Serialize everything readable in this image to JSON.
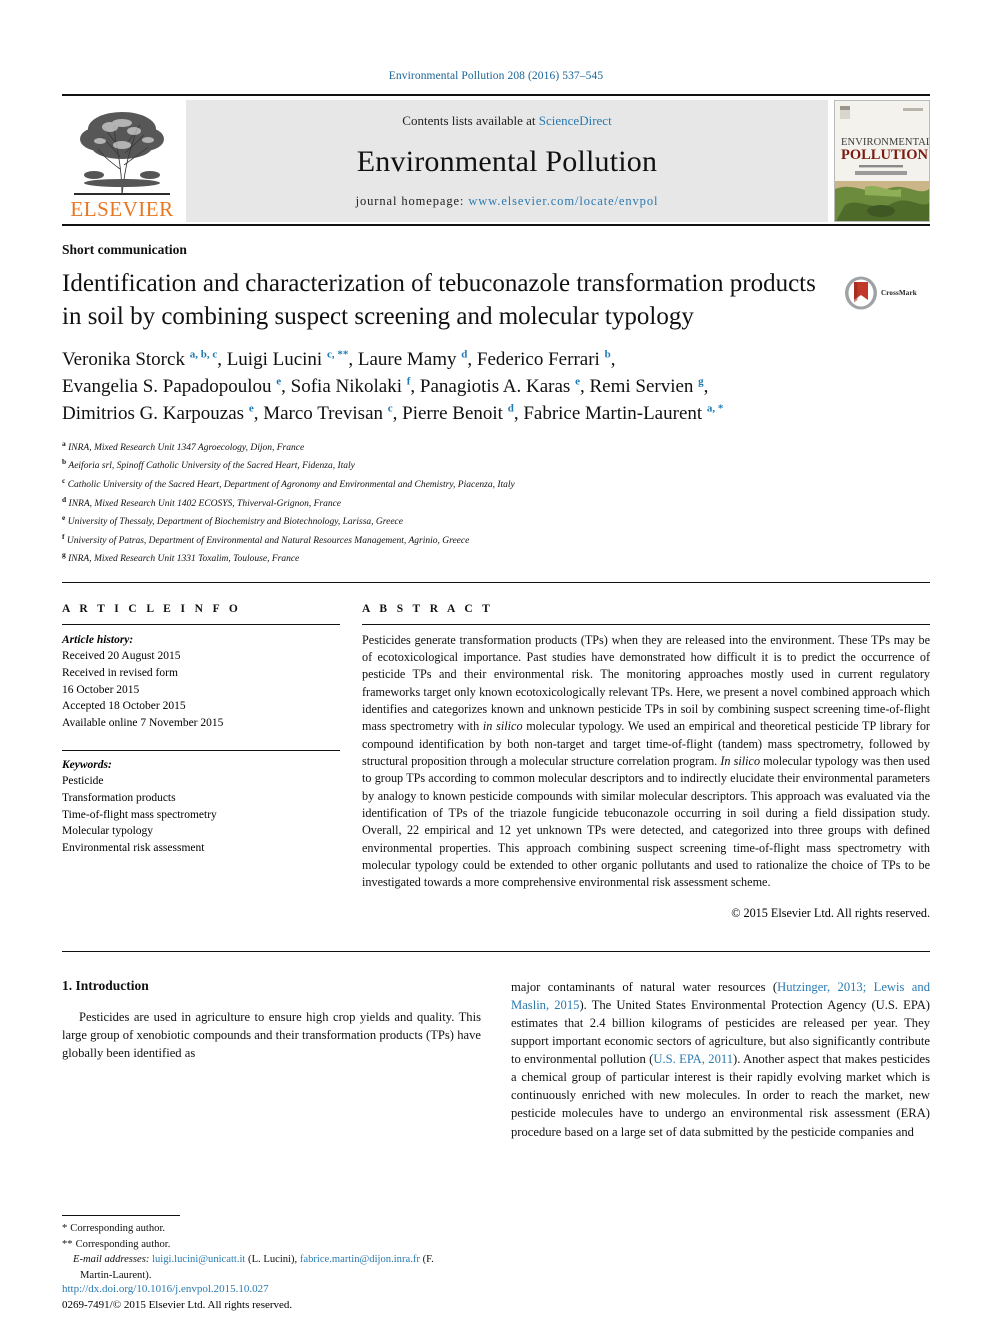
{
  "running_head": "Environmental Pollution 208 (2016) 537–545",
  "masthead": {
    "publisher_logo_name": "elsevier-tree-logo",
    "publisher_word": "ELSEVIER",
    "contents_prefix": "Contents lists available at ",
    "contents_link": "ScienceDirect",
    "journal_name": "Environmental Pollution",
    "homepage_prefix": "journal homepage: ",
    "homepage_url": "www.elsevier.com/locate/envpol",
    "cover_title_line1": "ENVIRONMENTAL",
    "cover_title_line2": "POLLUTION"
  },
  "article": {
    "doctype": "Short communication",
    "title": "Identification and characterization of tebuconazole transformation products in soil by combining suspect screening and molecular typology",
    "crossmark_label": "CrossMark",
    "authors_lines": [
      "Veronika Storck a, b, c, Luigi Lucini c, **, Laure Mamy d, Federico Ferrari b,",
      "Evangelia S. Papadopoulou e, Sofia Nikolaki f, Panagiotis A. Karas e, Remi Servien g,",
      "Dimitrios G. Karpouzas e, Marco Trevisan c, Pierre Benoit d, Fabrice Martin-Laurent a, *"
    ],
    "affiliations": [
      {
        "marker": "a",
        "text": "INRA, Mixed Research Unit 1347 Agroecology, Dijon, France"
      },
      {
        "marker": "b",
        "text": "Aeiforia srl, Spinoff Catholic University of the Sacred Heart, Fidenza, Italy"
      },
      {
        "marker": "c",
        "text": "Catholic University of the Sacred Heart, Department of Agronomy and Environmental and Chemistry, Piacenza, Italy"
      },
      {
        "marker": "d",
        "text": "INRA, Mixed Research Unit 1402 ECOSYS, Thiverval-Grignon, France"
      },
      {
        "marker": "e",
        "text": "University of Thessaly, Department of Biochemistry and Biotechnology, Larissa, Greece"
      },
      {
        "marker": "f",
        "text": "University of Patras, Department of Environmental and Natural Resources Management, Agrinio, Greece"
      },
      {
        "marker": "g",
        "text": "INRA, Mixed Research Unit 1331 Toxalim, Toulouse, France"
      }
    ]
  },
  "article_info": {
    "heading": "A R T I C L E  I N F O",
    "history_label": "Article history:",
    "history": [
      "Received 20 August 2015",
      "Received in revised form",
      "16 October 2015",
      "Accepted 18 October 2015",
      "Available online 7 November 2015"
    ],
    "keywords_label": "Keywords:",
    "keywords": [
      "Pesticide",
      "Transformation products",
      "Time-of-flight mass spectrometry",
      "Molecular typology",
      "Environmental risk assessment"
    ]
  },
  "abstract": {
    "heading": "A B S T R A C T",
    "paragraph_part1": "Pesticides generate transformation products (TPs) when they are released into the environment. These TPs may be of ecotoxicological importance. Past studies have demonstrated how difficult it is to predict the occurrence of pesticide TPs and their environmental risk. The monitoring approaches mostly used in current regulatory frameworks target only known ecotoxicologically relevant TPs. Here, we present a novel combined approach which identifies and categorizes known and unknown pesticide TPs in soil by combining suspect screening time-of-flight mass spectrometry with ",
    "italic1": "in silico",
    "paragraph_part2": " molecular typology. We used an empirical and theoretical pesticide TP library for compound identification by both non-target and target time-of-flight (tandem) mass spectrometry, followed by structural proposition through a molecular structure correlation program. ",
    "italic2": "In silico",
    "paragraph_part3": " molecular typology was then used to group TPs according to common molecular descriptors and to indirectly elucidate their environmental parameters by analogy to known pesticide compounds with similar molecular descriptors. This approach was evaluated via the identification of TPs of the triazole fungicide tebuconazole occurring in soil during a field dissipation study. Overall, 22 empirical and 12 yet unknown TPs were detected, and categorized into three groups with defined environmental properties. This approach combining suspect screening time-of-flight mass spectrometry with molecular typology could be extended to other organic pollutants and used to rationalize the choice of TPs to be investigated towards a more comprehensive environmental risk assessment scheme.",
    "copyright": "© 2015 Elsevier Ltd. All rights reserved."
  },
  "introduction": {
    "number_title": "1. Introduction",
    "left_paragraph": "Pesticides are used in agriculture to ensure high crop yields and quality. This large group of xenobiotic compounds and their transformation products (TPs) have globally been identified as",
    "right_part1": "major contaminants of natural water resources (",
    "right_cite1": "Hutzinger, 2013;",
    "right_cite2": "Lewis and Maslin, 2015",
    "right_part2": "). The United States Environmental Protection Agency (U.S. EPA) estimates that 2.4 billion kilograms of pesticides are released per year. They support important economic sectors of agriculture, but also significantly contribute to environmental pollution (",
    "right_cite3": "U.S. EPA, 2011",
    "right_part3": "). Another aspect that makes pesticides a chemical group of particular interest is their rapidly evolving market which is continuously enriched with new molecules. In order to reach the market, new pesticide molecules have to undergo an environmental risk assessment (ERA) procedure based on a large set of data submitted by the pesticide companies and"
  },
  "footnotes": {
    "corresponding_1_marker": "*",
    "corresponding_1": "Corresponding author.",
    "corresponding_2_marker": "**",
    "corresponding_2": "Corresponding author.",
    "email_label": "E-mail addresses:",
    "email_1": "luigi.lucini@unicatt.it",
    "email_1_name": "(L. Lucini),",
    "email_2": "fabrice.martin@dijon.inra.fr",
    "email_2_name": "(F. Martin-Laurent)."
  },
  "doi_block": {
    "doi": "http://dx.doi.org/10.1016/j.envpol.2015.10.027",
    "issn_line": "0269-7491/© 2015 Elsevier Ltd. All rights reserved."
  },
  "colors": {
    "link_blue": "#2a7ab0",
    "elsevier_orange": "#E87722",
    "masthead_gray": "#e7e7e7",
    "crossmark_red": "#c0392b"
  }
}
